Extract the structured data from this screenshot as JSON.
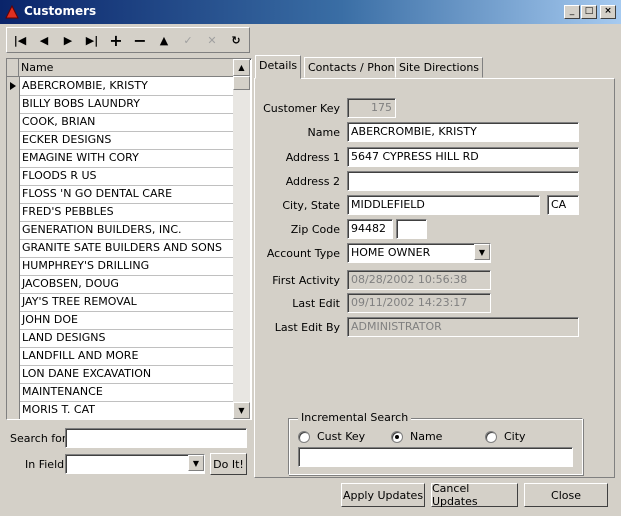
{
  "window": {
    "title": "Customers"
  },
  "tabs": [
    "Details",
    "Contacts / Phone",
    "Site Directions"
  ],
  "grid": {
    "header": "Name",
    "rows": [
      "ABERCROMBIE, KRISTY",
      "BILLY BOBS LAUNDRY",
      "COOK, BRIAN",
      "ECKER DESIGNS",
      "EMAGINE WITH CORY",
      "FLOODS R US",
      "FLOSS 'N GO DENTAL CARE",
      "FRED'S PEBBLES",
      "GENERATION BUILDERS, INC.",
      "GRANITE SATE BUILDERS AND SONS",
      "HUMPHREY'S DRILLING",
      "JACOBSEN, DOUG",
      "JAY'S TREE REMOVAL",
      "JOHN DOE",
      "LAND DESIGNS",
      "LANDFILL AND MORE",
      "LON DANE EXCAVATION",
      "MAINTENANCE",
      "MORIS T. CAT"
    ]
  },
  "search": {
    "search_label": "Search for",
    "search_value": "",
    "in_field_label": "In Field",
    "in_field_value": "",
    "doit_label": "Do It!"
  },
  "details": {
    "customer_key_label": "Customer Key",
    "customer_key": "175",
    "name_label": "Name",
    "name": "ABERCROMBIE, KRISTY",
    "address1_label": "Address 1",
    "address1": "5647 CYPRESS HILL RD",
    "address2_label": "Address 2",
    "address2": "",
    "city_state_label": "City, State",
    "city": "MIDDLEFIELD",
    "state": "CA",
    "zip_label": "Zip Code",
    "zip": "94482",
    "zip_ext": "",
    "account_type_label": "Account Type",
    "account_type": "HOME OWNER",
    "first_activity_label": "First Activity",
    "first_activity": "08/28/2002 10:56:38",
    "last_edit_label": "Last Edit",
    "last_edit": "09/11/2002 14:23:17",
    "last_edit_by_label": "Last Edit By",
    "last_edit_by": "ADMINISTRATOR"
  },
  "incremental_search": {
    "legend": "Incremental Search",
    "options": [
      "Cust Key",
      "Name",
      "City"
    ],
    "selected": "Name",
    "value": ""
  },
  "footer": {
    "apply": "Apply Updates",
    "cancel": "Cancel Updates",
    "close": "Close"
  },
  "icons": {
    "nav": [
      "first-record-icon",
      "prior-record-icon",
      "next-record-icon",
      "last-record-icon",
      "insert-record-icon",
      "delete-record-icon",
      "edit-record-icon",
      "post-edit-icon",
      "cancel-edit-icon",
      "refresh-icon"
    ]
  }
}
